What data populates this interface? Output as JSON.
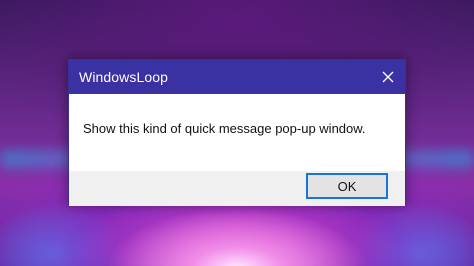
{
  "dialog": {
    "title": "WindowsLoop",
    "message": "Show this kind of quick message pop-up window.",
    "ok_label": "OK",
    "close_icon": "close-icon"
  },
  "colors": {
    "titlebar": "#3a31a3",
    "ok_focus_border": "#1a74d8"
  }
}
